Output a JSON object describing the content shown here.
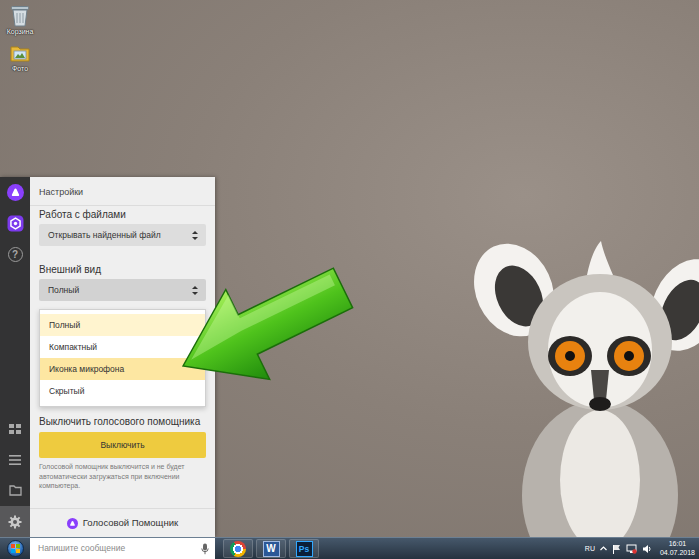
{
  "desktop": {
    "icons": [
      {
        "label": "Корзина",
        "kind": "recycle-bin"
      },
      {
        "label": "Фото",
        "kind": "folder"
      }
    ]
  },
  "assistant": {
    "rail": [
      {
        "kind": "alice",
        "selected": false
      },
      {
        "kind": "apps",
        "selected": false
      },
      {
        "kind": "help",
        "glyph": "?",
        "selected": false
      },
      {
        "kind": "grid",
        "selected": false
      },
      {
        "kind": "list",
        "selected": false
      },
      {
        "kind": "folder",
        "selected": false
      },
      {
        "kind": "settings",
        "selected": true
      }
    ],
    "settings": {
      "title": "Настройки",
      "files": {
        "label": "Работа с файлами",
        "value": "Открывать найденный файл"
      },
      "appearance": {
        "label": "Внешний вид",
        "value": "Полный",
        "expanded": true,
        "options": [
          {
            "label": "Полный",
            "selected": true,
            "highlighted": false
          },
          {
            "label": "Компактный",
            "selected": false,
            "highlighted": false
          },
          {
            "label": "Иконка микрофона",
            "selected": false,
            "highlighted": true
          },
          {
            "label": "Скрытый",
            "selected": false,
            "highlighted": false
          }
        ]
      },
      "disable": {
        "label": "Выключить голосового помощника",
        "button": "Выключить",
        "note": "Голосовой помощник выключится и не будет автоматически загружаться при включении компьютера."
      },
      "footer": "Голосовой Помощник"
    },
    "message": {
      "placeholder": "Напишите сообщение"
    }
  },
  "taskbar": {
    "apps": [
      {
        "kind": "chrome"
      },
      {
        "kind": "word",
        "glyph": "W"
      },
      {
        "kind": "photoshop",
        "glyph": "Ps"
      }
    ],
    "tray": {
      "language": "RU",
      "time": "16:01",
      "date": "04.07.2018"
    }
  }
}
